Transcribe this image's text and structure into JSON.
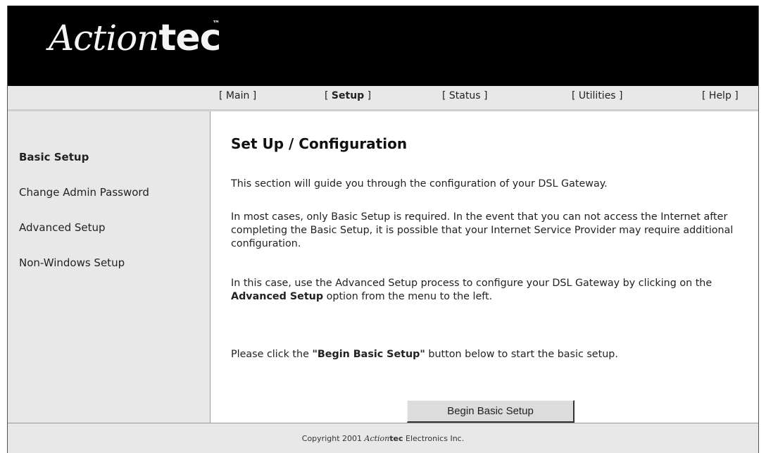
{
  "header": {
    "logo_script": "Action",
    "logo_bold": "tec",
    "logo_tm": "™"
  },
  "nav": {
    "main": "[ Main ]",
    "setup_open": "[ ",
    "setup": "Setup",
    "setup_close": " ]",
    "status": "[ Status ]",
    "utilities": "[ Utilities ]",
    "help": "[ Help ]",
    "active_item": "Setup"
  },
  "sidebar": {
    "items": [
      {
        "label": "Basic Setup",
        "active": true
      },
      {
        "label": "Change Admin Password",
        "active": false
      },
      {
        "label": "Advanced Setup",
        "active": false
      },
      {
        "label": "Non-Windows Setup",
        "active": false
      }
    ]
  },
  "main": {
    "title": "Set Up / Configuration",
    "para1": "This section will guide you through the configuration of your DSL Gateway.",
    "para2": "In most cases, only Basic Setup is required. In the event that you can not access the Internet after completing the Basic Setup, it is possible that your Internet Service Provider may require additional configuration.",
    "para3_a": "In this case, use the Advanced Setup process to configure your DSL Gateway by clicking on the ",
    "para3_b": "Advanced Setup",
    "para3_c": " option from the menu to the left.",
    "para4_a": "Please click the ",
    "para4_b": "\"Begin Basic Setup\"",
    "para4_c": " button below to start the basic setup.",
    "button_label": "Begin Basic Setup"
  },
  "footer": {
    "copyright_prefix": "Copyright 2001 ",
    "brand_script": "Action",
    "brand_bold": "tec",
    "copyright_suffix": " Electronics Inc."
  },
  "colors": {
    "header_bg": "#000000",
    "panel_bg": "#e8e8e8",
    "content_bg": "#ffffff",
    "button_bg": "#dcdcdc"
  }
}
